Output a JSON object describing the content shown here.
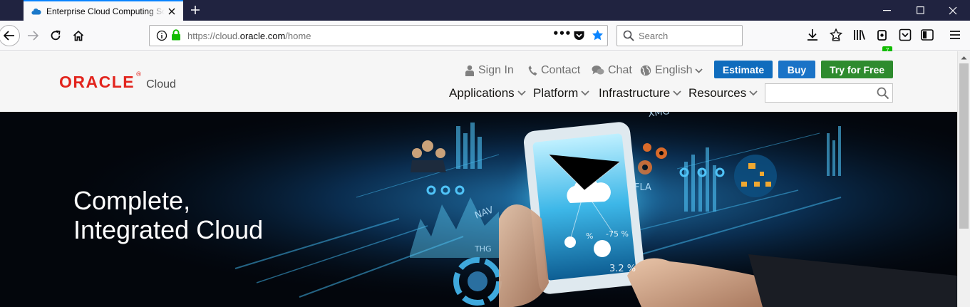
{
  "browser": {
    "tab_title": "Enterprise Cloud Computing Solutions",
    "url_prefix": "https://cloud.",
    "url_domain": "oracle.com",
    "url_path": "/home",
    "search_placeholder": "Search",
    "library_badge": "7",
    "page_actions": "•••"
  },
  "header": {
    "logo_oracle": "ORACLE",
    "logo_cloud": "Cloud",
    "utility": {
      "sign_in": "Sign In",
      "contact": "Contact",
      "chat": "Chat",
      "language": "English"
    },
    "buttons": {
      "estimate": "Estimate",
      "buy": "Buy",
      "try_free": "Try for Free"
    },
    "nav": [
      "Applications",
      "Platform",
      "Infrastructure",
      "Resources"
    ],
    "search_placeholder": ""
  },
  "hero": {
    "line1": "Complete,",
    "line2": "Integrated Cloud",
    "graphic_labels": [
      "XMG",
      "FLA",
      "NAV",
      "THG",
      "-75 %",
      "3.2 %",
      "%"
    ]
  },
  "colors": {
    "oracle_red": "#e2241d",
    "estimate_blue": "#0f6cbd",
    "buy_blue": "#1a73c7",
    "try_green": "#2e8b2e",
    "tabstrip": "#202340"
  }
}
